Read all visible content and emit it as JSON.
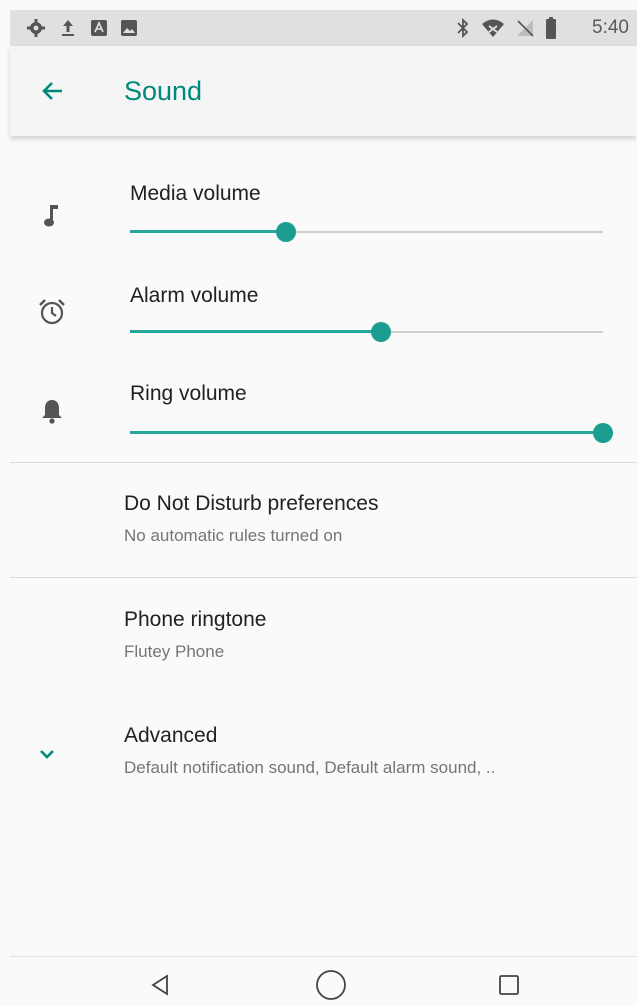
{
  "status_bar": {
    "time": "5:40",
    "left_icons": [
      "gear-icon",
      "upload-icon",
      "notification-a-icon",
      "image-icon"
    ],
    "right_icons": [
      "bluetooth-icon",
      "wifi-icon",
      "no-sim-icon",
      "battery-icon"
    ]
  },
  "app_bar": {
    "title": "Sound",
    "back_icon": "arrow-back-icon"
  },
  "volumes": [
    {
      "label": "Media volume",
      "icon": "music-note-icon",
      "level": 0.33
    },
    {
      "label": "Alarm volume",
      "icon": "alarm-clock-icon",
      "level": 0.53
    },
    {
      "label": "Ring volume",
      "icon": "bell-icon",
      "level": 1.0
    }
  ],
  "dnd": {
    "title": "Do Not Disturb preferences",
    "summary": "No automatic rules turned on"
  },
  "ringtone": {
    "title": "Phone ringtone",
    "summary": "Flutey Phone"
  },
  "advanced": {
    "title": "Advanced",
    "summary": "Default notification sound, Default alarm sound, .."
  },
  "nav_bar": {
    "buttons": [
      "back-triangle-icon",
      "home-circle-icon",
      "recents-square-icon"
    ]
  },
  "colors": {
    "accent": "#00897b",
    "slider": "#26a69a"
  }
}
